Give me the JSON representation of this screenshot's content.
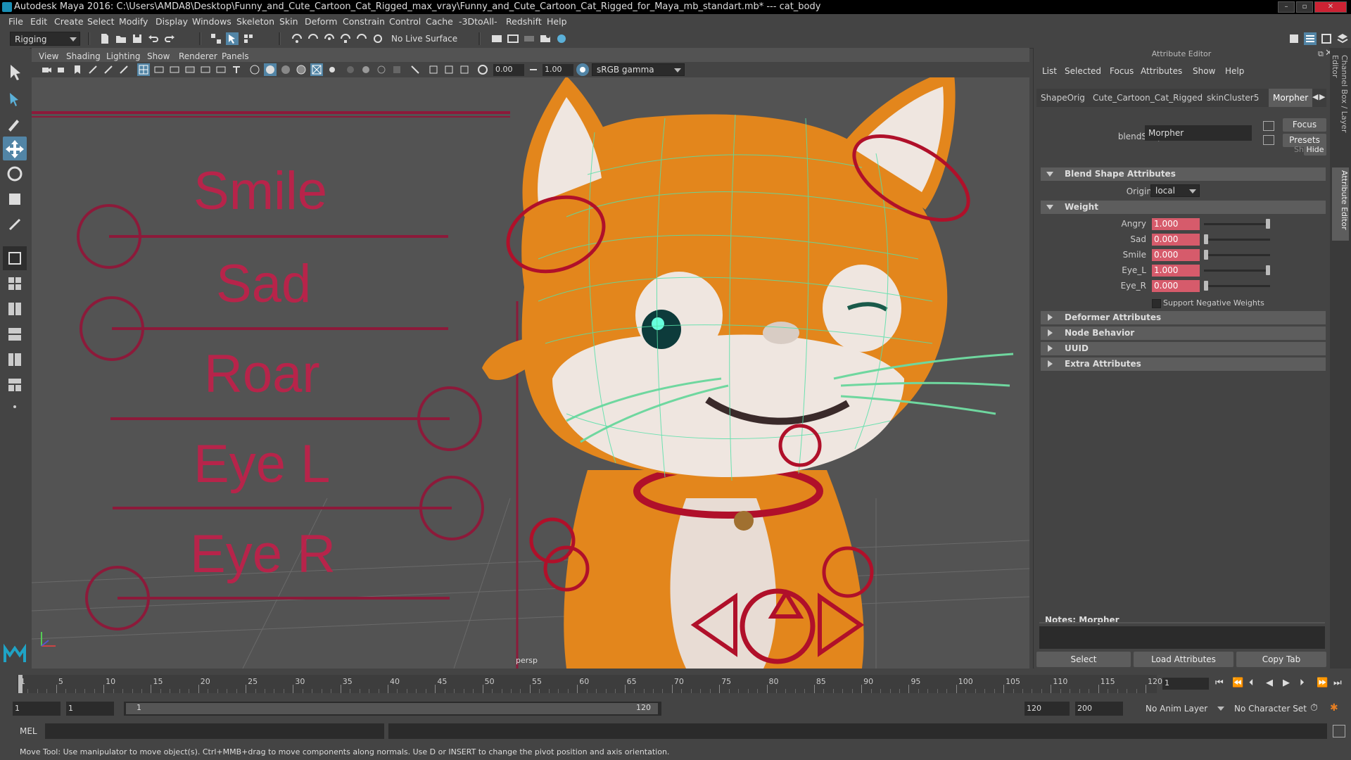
{
  "window": {
    "title": "Autodesk Maya 2016: C:\\Users\\AMDA8\\Desktop\\Funny_and_Cute_Cartoon_Cat_Rigged_max_vray\\Funny_and_Cute_Cartoon_Cat_Rigged_for_Maya_mb_standart.mb*   ---   cat_body"
  },
  "menubar": [
    "File",
    "Edit",
    "Create",
    "Select",
    "Modify",
    "Display",
    "Windows",
    "Skeleton",
    "Skin",
    "Deform",
    "Constrain",
    "Control",
    "Cache",
    "-3DtoAll-",
    "Redshift",
    "Help"
  ],
  "statusline": {
    "menuset": "Rigging",
    "live_surface": "No Live Surface"
  },
  "viewport": {
    "menus": [
      "View",
      "Shading",
      "Lighting",
      "Show",
      "Renderer",
      "Panels"
    ],
    "exposure": "0.00",
    "gamma": "1.00",
    "color_space": "sRGB gamma",
    "camera_label": "persp",
    "control_labels": [
      "Smile",
      "Sad",
      "Roar",
      "Eye L",
      "Eye R"
    ]
  },
  "attribute_editor": {
    "title": "Attribute Editor",
    "menus": [
      "List",
      "Selected",
      "Focus",
      "Attributes",
      "Show",
      "Help"
    ],
    "tabs": [
      "ShapeOrig",
      "Cute_Cartoon_Cat_Rigged",
      "skinCluster5",
      "Morpher"
    ],
    "active_tab": "Morpher",
    "node_type_label": "blendShape:",
    "node_name": "Morpher",
    "focus_btn": "Focus",
    "presets_btn": "Presets",
    "show_label": "Show",
    "hide_btn": "Hide",
    "sections": {
      "blend": "Blend Shape Attributes",
      "origin_label": "Origin",
      "origin_value": "local",
      "weight": "Weight",
      "deformer": "Deformer Attributes",
      "node_behavior": "Node Behavior",
      "uuid": "UUID",
      "extra": "Extra Attributes"
    },
    "weights": [
      {
        "name": "Angry",
        "value": "1.000",
        "level": 1.0
      },
      {
        "name": "Sad",
        "value": "0.000",
        "level": 0.0
      },
      {
        "name": "Smile",
        "value": "0.000",
        "level": 0.0
      },
      {
        "name": "Eye_L",
        "value": "1.000",
        "level": 1.0
      },
      {
        "name": "Eye_R",
        "value": "0.000",
        "level": 0.0
      }
    ],
    "support_negative": "Support Negative Weights",
    "notes_label": "Notes:  Morpher",
    "buttons": [
      "Select",
      "Load Attributes",
      "Copy Tab"
    ]
  },
  "side_tabs": [
    "Channel Box / Layer Editor",
    "Attribute Editor"
  ],
  "timeline": {
    "ticks": [
      "1",
      "5",
      "10",
      "15",
      "20",
      "25",
      "30",
      "35",
      "40",
      "45",
      "50",
      "55",
      "60",
      "65",
      "70",
      "75",
      "80",
      "85",
      "90",
      "95",
      "100",
      "105",
      "110",
      "115",
      "120"
    ],
    "current_frame": "1"
  },
  "range": {
    "start": "1",
    "start_inner": "1",
    "slider_start": "1",
    "slider_end": "120",
    "end_inner": "120",
    "end": "200",
    "anim_layer": "No Anim Layer",
    "char_set": "No Character Set"
  },
  "command_line": {
    "lang": "MEL"
  },
  "help_line": "Move Tool: Use manipulator to move object(s). Ctrl+MMB+drag to move components along normals. Use D or INSERT to change the pivot position and axis orientation."
}
